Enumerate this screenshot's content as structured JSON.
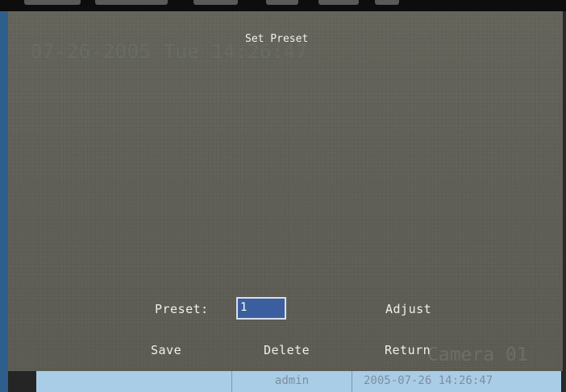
{
  "osd": {
    "datetime": "07-26-2005 Tue 14:26:47",
    "camera_name": "Camera 01"
  },
  "menu": {
    "title": "Set Preset",
    "preset_label": "Preset:",
    "preset_value": "1",
    "adjust_label": "Adjust",
    "save_label": "Save",
    "delete_label": "Delete",
    "return_label": "Return"
  },
  "status_bar": {
    "user": "admin",
    "timestamp": "2005-07-26 14:26:47"
  },
  "colors": {
    "input_bg": "#3b5f9e",
    "status_bar_bg": "#a9cde6",
    "video_bg": "#5f5f56"
  }
}
